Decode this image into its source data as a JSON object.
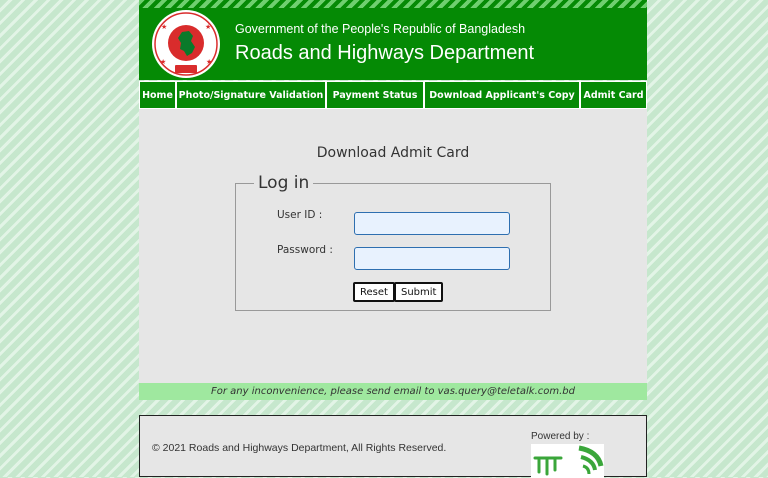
{
  "header": {
    "government": "Government of the People's Republic of Bangladesh",
    "department": "Roads and Highways Department"
  },
  "nav": {
    "items": [
      {
        "label": "Home"
      },
      {
        "label": "Photo/Signature Validation"
      },
      {
        "label": "Payment Status"
      },
      {
        "label": "Download Applicant's Copy"
      },
      {
        "label": "Admit Card"
      }
    ]
  },
  "main": {
    "title": "Download Admit Card",
    "legend": "Log in",
    "user_id_label": "User ID :",
    "user_id_value": "",
    "password_label": "Password :",
    "password_value": "",
    "reset_label": "Reset",
    "submit_label": "Submit"
  },
  "notice": "For any inconvenience, please send email to vas.query@teletalk.com.bd",
  "footer": {
    "copyright": "© 2021 Roads and Highways Department, All Rights Reserved.",
    "powered_by": "Powered by :"
  },
  "colors": {
    "header_green": "#058a05",
    "nav_green": "#058a05",
    "notice_green": "#9fe89f",
    "panel_grey": "#e6e6e6",
    "seal_red": "#d92c2c"
  },
  "icons": {
    "seal": "bangladesh-government-seal",
    "logo": "teletalk-logo"
  }
}
